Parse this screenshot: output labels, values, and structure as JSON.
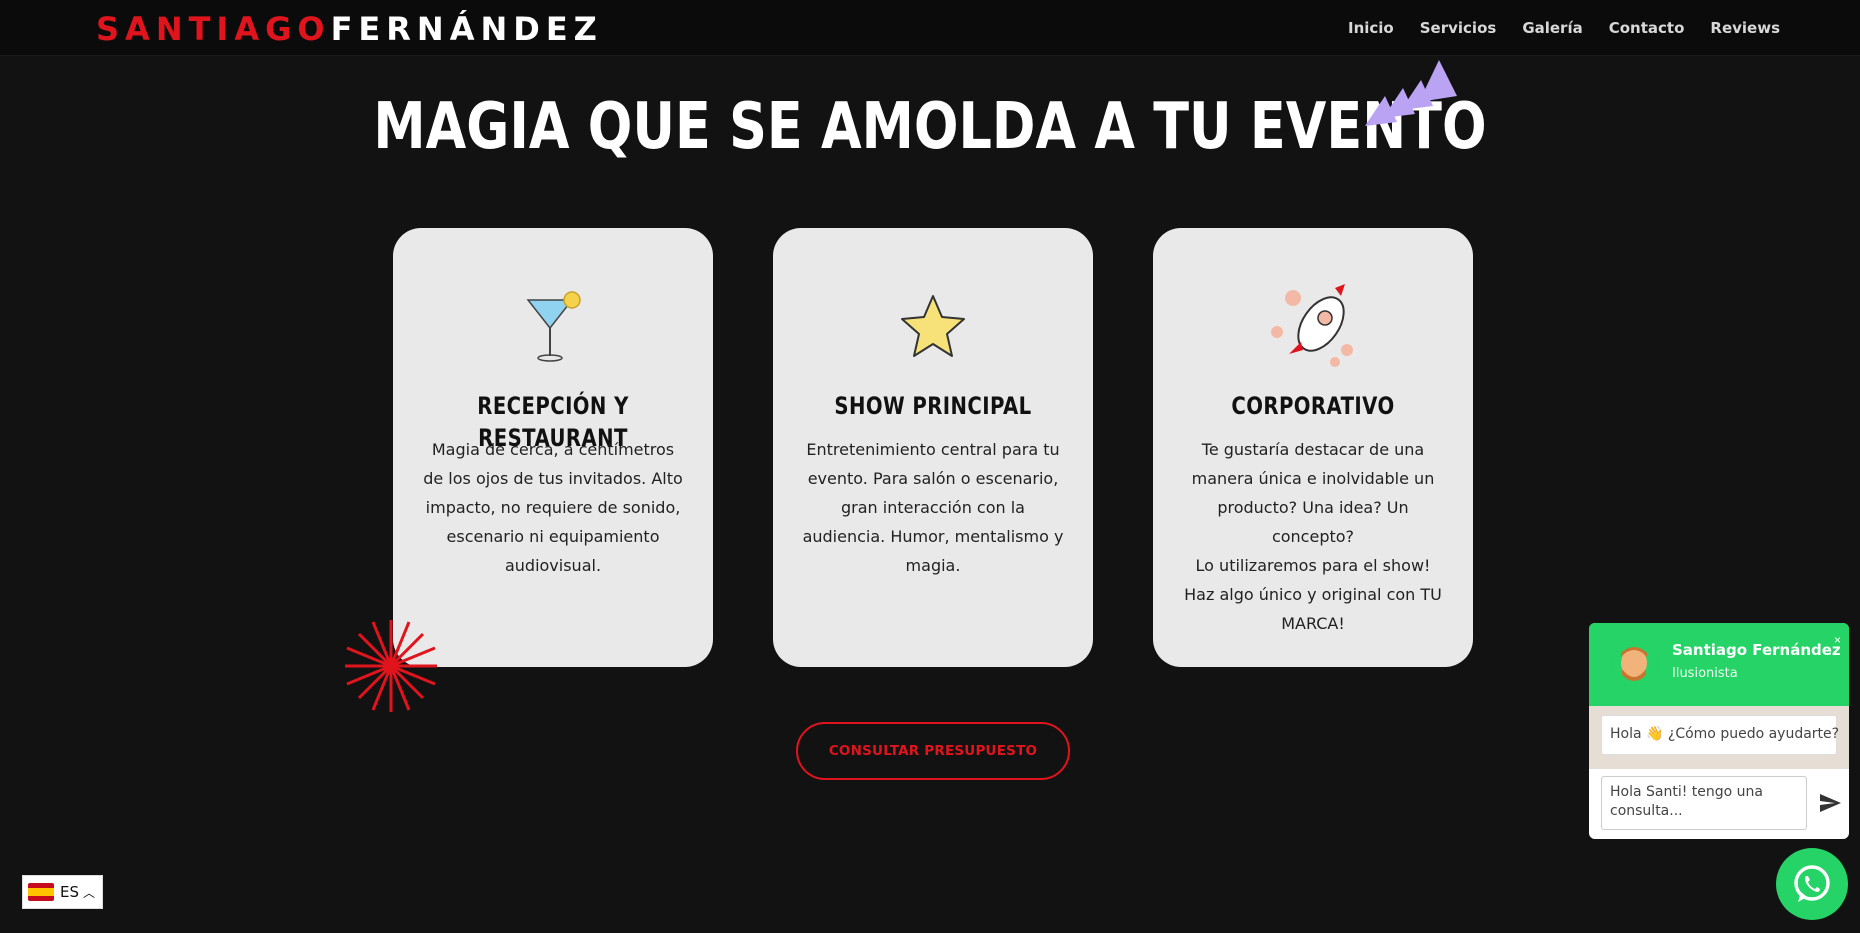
{
  "header": {
    "logo_part1": "SANTIAGO",
    "logo_part2": "FERNÁNDEZ",
    "nav": [
      "Inicio",
      "Servicios",
      "Galería",
      "Contacto",
      "Reviews"
    ]
  },
  "main": {
    "title": "MAGIA QUE SE AMOLDA A TU EVENTO",
    "cards": [
      {
        "icon": "cocktail-glass-icon",
        "title": "RECEPCIÓN Y RESTAURANT",
        "text": "Magia de cerca, a centímetros de los ojos de tus invitados. Alto impacto, no requiere de sonido, escenario ni equipamiento audiovisual."
      },
      {
        "icon": "star-icon",
        "title": "SHOW PRINCIPAL",
        "text": "Entretenimiento central para tu evento. Para salón o escenario, gran interacción con la audiencia. Humor, mentalismo y magia."
      },
      {
        "icon": "rocket-icon",
        "title": "CORPORATIVO",
        "text": "Te gustaría destacar de una manera única e inolvidable un producto? Una idea? Un concepto?",
        "text2": "Lo utilizaremos para el show! Haz algo único y original con TU MARCA!"
      }
    ],
    "cta_label": "CONSULTAR PRESUPUESTO"
  },
  "language": {
    "code": "ES",
    "flag": "spain-flag-icon"
  },
  "chat": {
    "name": "Santiago Fernández",
    "role": "Ilusionista",
    "greeting": "Hola 👋 ¿Cómo puedo ayudarte?",
    "input_value": "Hola Santi! tengo una consulta...",
    "close": "×"
  },
  "colors": {
    "background": "#121212",
    "brand_red": "#e0141c",
    "card_bg": "#e9e9e9",
    "whatsapp_green": "#25d366",
    "accent_purple": "#b9a3f2"
  }
}
